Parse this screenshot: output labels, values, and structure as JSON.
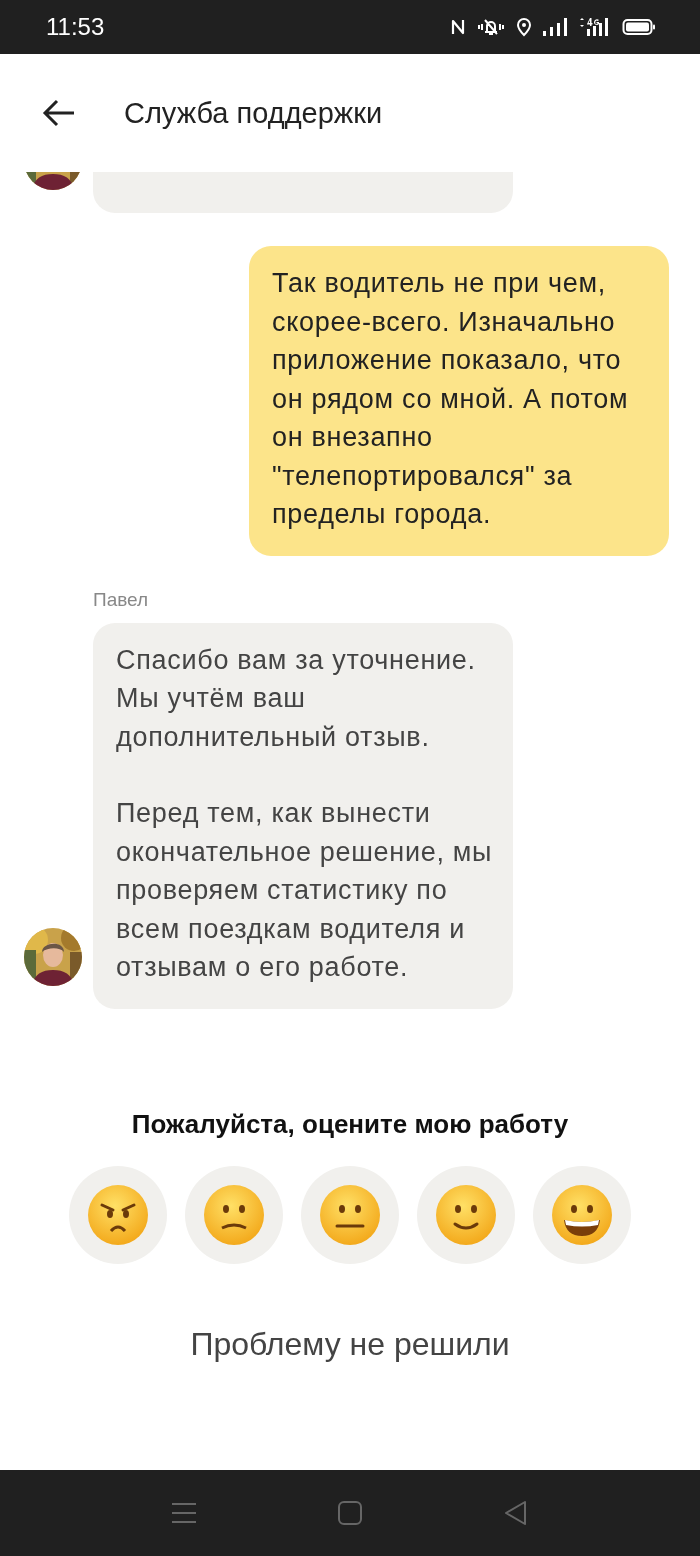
{
  "status_bar": {
    "time": "11:53"
  },
  "header": {
    "title": "Служба поддержки"
  },
  "messages": [
    {
      "kind": "operator",
      "avatar": true
    },
    {
      "kind": "user",
      "paragraphs": [
        "Так водитель не при чем, скорее-всего. Изначально приложение показало, что он рядом со мной. А потом он внезапно \"телепортировался\" за пределы города."
      ]
    },
    {
      "kind": "operator",
      "sender": "Павел",
      "avatar": true,
      "paragraphs": [
        "Спасибо вам за уточнение. Мы учтём ваш дополнительный отзыв.",
        "Перед тем, как вынести окончательное решение, мы проверяем статистику по всем поездкам водителя и отзывам о его работе."
      ]
    }
  ],
  "rating": {
    "title": "Пожалуйста, оцените мою работу",
    "options": [
      {
        "kind": "angry"
      },
      {
        "kind": "confused"
      },
      {
        "kind": "neutral"
      },
      {
        "kind": "smile"
      },
      {
        "kind": "grin"
      }
    ]
  },
  "unsolved_button": "Проблему не решили"
}
